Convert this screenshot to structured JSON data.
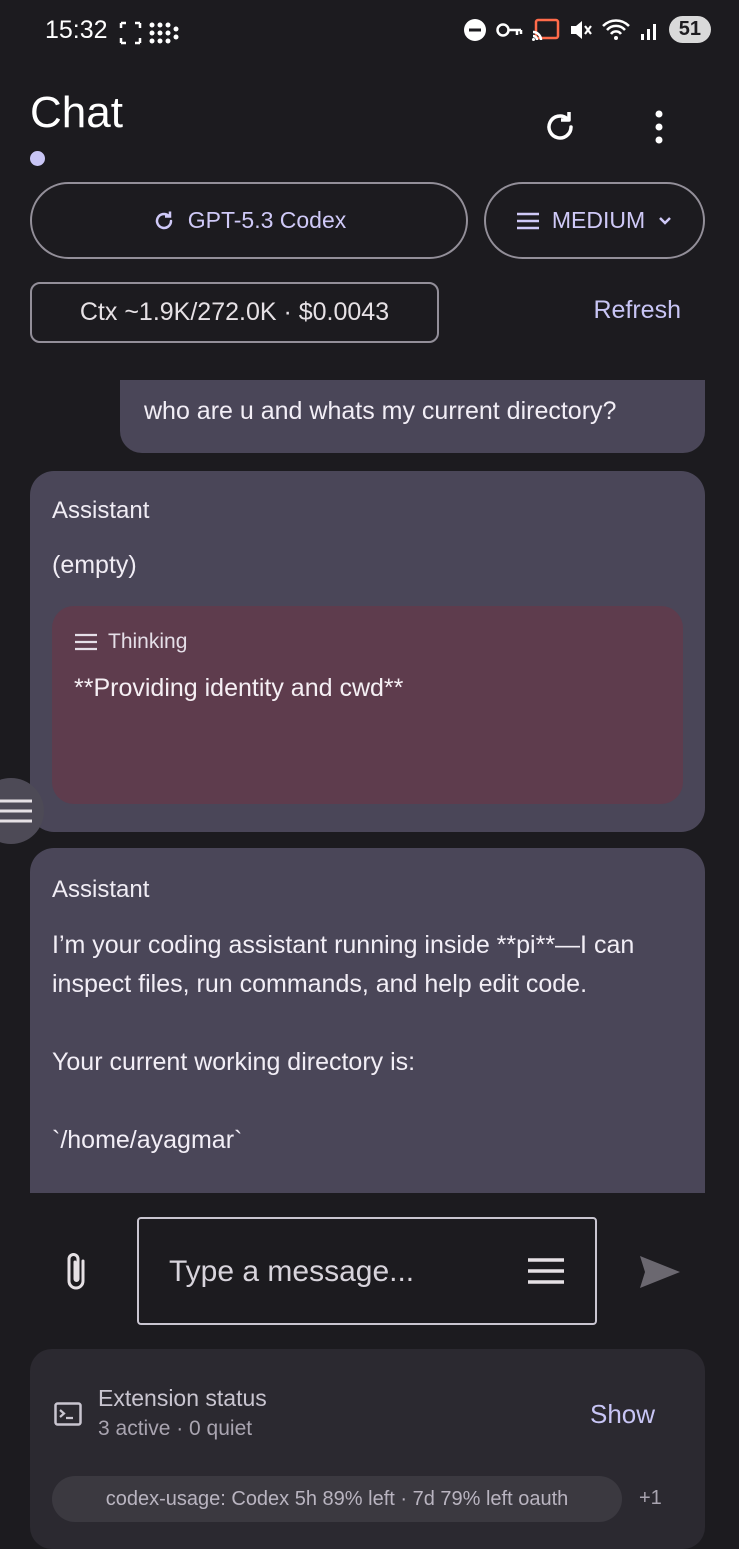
{
  "status_bar": {
    "time": "15:32",
    "battery": "51"
  },
  "header": {
    "title": "Chat"
  },
  "model_selector": {
    "label": "GPT-5.3 Codex"
  },
  "effort_selector": {
    "label": "MEDIUM"
  },
  "context": {
    "text": "Ctx ~1.9K/272.0K · $0.0043",
    "refresh_label": "Refresh"
  },
  "messages": {
    "user": {
      "text": "who are u and whats my current directory?"
    },
    "assistant_1": {
      "label": "Assistant",
      "content": "(empty)",
      "thinking_label": "Thinking",
      "thinking_text": "**Providing identity and cwd**"
    },
    "assistant_2": {
      "label": "Assistant",
      "text": "I’m your coding assistant running inside **pi**—I can inspect files, run commands, and help edit code.\n\nYour current working directory is:\n\n`/home/ayagmar`"
    }
  },
  "composer": {
    "placeholder": "Type a message..."
  },
  "extension_status": {
    "title": "Extension status",
    "summary": "3 active · 0 quiet",
    "show_label": "Show",
    "chip": "codex-usage: Codex 5h 89% left · 7d 79% left oauth",
    "more": "+1"
  },
  "colors": {
    "accent": "#c8c5f5",
    "card": "#4a4658",
    "thinking": "#5e3c4d",
    "background": "#1c1b1f"
  }
}
